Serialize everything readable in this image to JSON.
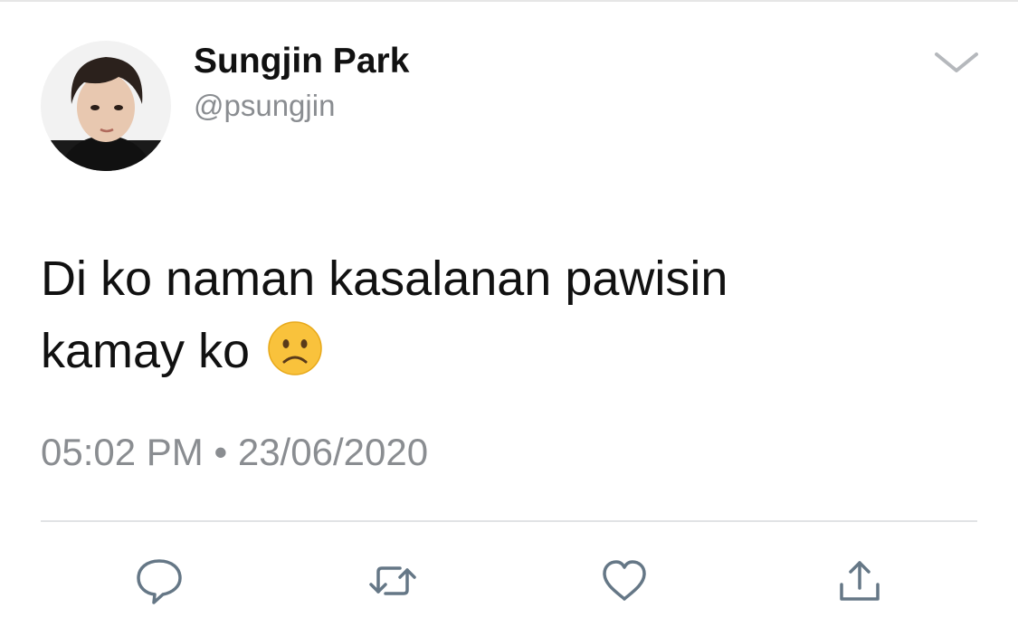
{
  "tweet": {
    "display_name": "Sungjin Park",
    "handle": "@psungjin",
    "text": "Di ko naman kasalanan pawisin\nkamay ko",
    "emoji": "frowning-face-emoji",
    "time": "05:02 PM",
    "separator": "•",
    "date": "23/06/2020"
  },
  "icons": {
    "menu": "chevron-down-icon",
    "reply": "reply-bubble-icon",
    "retweet": "retweet-icon",
    "like": "heart-icon",
    "share": "share-upload-icon"
  },
  "colors": {
    "primary_text": "#111111",
    "secondary_text": "#8a8d91",
    "icon_gray": "#657786",
    "divider": "#e1e3e5",
    "emoji_yellow": "#f9c23c"
  }
}
